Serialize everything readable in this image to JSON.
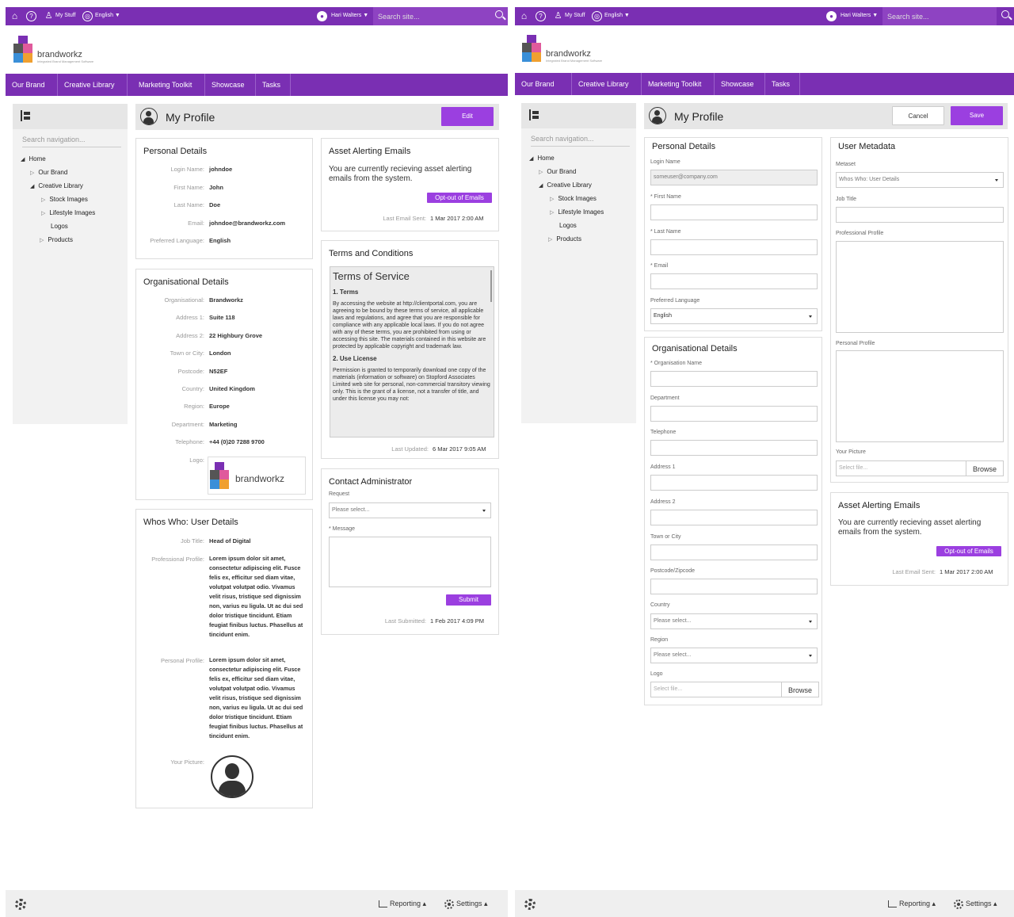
{
  "topbar": {
    "my_stuff": "My Stuff",
    "language": "English ▼",
    "user": "Hari Walters ▼",
    "search_placeholder": "Search site..."
  },
  "brand": {
    "name": "brandworkz",
    "tagline": "Integrated Brand Management Software"
  },
  "nav": [
    "Our Brand",
    "Creative Library",
    "Marketing Toolkit",
    "Showcase",
    "Tasks"
  ],
  "sidebar": {
    "search_placeholder": "Search navigation...",
    "tree": [
      "Home",
      "Our Brand",
      "Creative Library",
      "Stock Images",
      "Lifestyle Images",
      "Logos",
      "Products"
    ]
  },
  "view": {
    "title": "My Profile",
    "edit": "Edit",
    "personal": {
      "title": "Personal Details",
      "rows": [
        [
          "Login Name:",
          "johndoe"
        ],
        [
          "First Name:",
          "John"
        ],
        [
          "Last Name:",
          "Doe"
        ],
        [
          "Email:",
          "johndoe@brandworkz.com"
        ],
        [
          "Preferred Language:",
          "English"
        ]
      ]
    },
    "org": {
      "title": "Organisational Details",
      "rows": [
        [
          "Organisational:",
          "Brandworkz"
        ],
        [
          "Address 1:",
          "Suite 118"
        ],
        [
          "Address 2:",
          "22 Highbury Grove"
        ],
        [
          "Town or City:",
          "London"
        ],
        [
          "Postcode:",
          "N52EF"
        ],
        [
          "Country:",
          "United Kingdom"
        ],
        [
          "Region:",
          "Europe"
        ],
        [
          "Department:",
          "Marketing"
        ],
        [
          "Telephone:",
          "+44 (0)20 7288 9700"
        ]
      ],
      "logo_label": "Logo:"
    },
    "whos": {
      "title": "Whos Who: User Details",
      "job_label": "Job Title:",
      "job": "Head of Digital",
      "prof_label": "Professional Profile:",
      "prof": "Lorem ipsum dolor sit amet, consectetur adipiscing elit. Fusce felis ex, efficitur sed diam vitae, volutpat volutpat odio. Vivamus velit risus, tristique sed dignissim non, varius eu ligula. Ut ac dui sed dolor tristique tincidunt. Etiam feugiat finibus luctus. Phasellus at tincidunt enim.",
      "pers_label": "Personal Profile:",
      "pers": "Lorem ipsum dolor sit amet, consectetur adipiscing elit. Fusce felis ex, efficitur sed diam vitae, volutpat volutpat odio. Vivamus velit risus, tristique sed dignissim non, varius eu ligula. Ut ac dui sed dolor tristique tincidunt. Etiam feugiat finibus luctus. Phasellus at tincidunt enim.",
      "pic_label": "Your Picture:"
    },
    "alert": {
      "title": "Asset Alerting Emails",
      "text": "You are currently recieving asset alerting emails from the system.",
      "btn": "Opt-out of Emails",
      "sent_label": "Last Email Sent:",
      "sent": "1 Mar 2017  2:00 AM"
    },
    "terms": {
      "title": "Terms and Conditions",
      "heading": "Terms of Service",
      "s1": "1. Terms",
      "p1": "By accessing the website at http://clientportal.com, you are agreeing to be bound by these terms of service, all applicable laws and regulations, and agree that you are responsible for compliance with any applicable local laws. If you do not agree with any of these terms, you are prohibited from using or accessing this site. The materials contained in this website are protected by applicable copyright and trademark law.",
      "s2": "2. Use License",
      "p2": "Permission is granted to temporarily download one copy of the materials (information or software) on Stopford Associates Limited web site for personal, non-commercial transitory viewing only. This is the grant of a license, not a transfer of title, and under this license you may not:",
      "updated_label": "Last Updated:",
      "updated": "6 Mar 2017  9:05 AM"
    },
    "contact": {
      "title": "Contact Administrator",
      "req_label": "Request",
      "req": "Please select...",
      "msg_label": "* Message",
      "submit": "Submit",
      "submitted_label": "Last Submitted:",
      "submitted": "1 Feb 2017  4:09 PM"
    }
  },
  "edit": {
    "title": "My Profile",
    "cancel": "Cancel",
    "save": "Save",
    "personal": {
      "title": "Personal Details",
      "login_label": "Login Name",
      "login": "someuser@company.com",
      "first": "* First Name",
      "last": "* Last Name",
      "email": "* Email",
      "lang_label": "Preferred Language",
      "lang": "English"
    },
    "org": {
      "title": "Organisational Details",
      "fields": [
        "* Organisation Name",
        "Department",
        "Telephone",
        "Address 1",
        "Address 2",
        "Town or City",
        "Postcode/Zipcode"
      ],
      "country_label": "Country",
      "country": "Please select...",
      "region_label": "Region",
      "region": "Please select...",
      "logo_label": "Logo",
      "file": "Select file...",
      "browse": "Browse"
    },
    "meta": {
      "title": "User Metadata",
      "metaset_label": "Metaset",
      "metaset": "Whos Who: User Details",
      "job": "Job Title",
      "prof": "Professional Profile",
      "pers": "Personal Profile",
      "pic": "Your Picture",
      "file": "Select file...",
      "browse": "Browse"
    },
    "alert": {
      "title": "Asset Alerting Emails",
      "text": "You are currently recieving asset alerting emails from the system.",
      "btn": "Opt-out of Emails",
      "sent_label": "Last Email Sent:",
      "sent": "1 Mar 2017  2:00 AM"
    }
  },
  "footer": {
    "reporting": "Reporting ▴",
    "settings": "Settings ▴"
  }
}
